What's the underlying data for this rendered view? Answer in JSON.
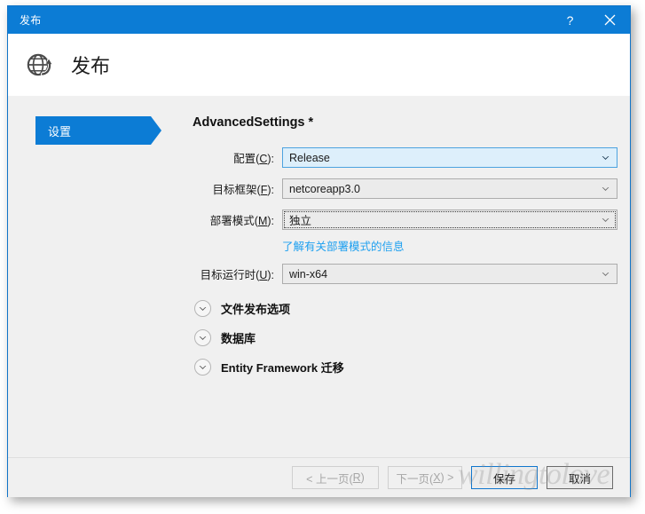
{
  "window": {
    "title": "发布",
    "help_label": "?",
    "close_label": "✕"
  },
  "header": {
    "icon": "globe-publish-icon",
    "title": "发布"
  },
  "sidebar": {
    "items": [
      {
        "label": "设置",
        "selected": true
      }
    ]
  },
  "main": {
    "section_title": "AdvancedSettings *",
    "fields": [
      {
        "label_prefix": "配置(",
        "label_key": "C",
        "label_suffix": "):",
        "value": "Release",
        "state": "focused"
      },
      {
        "label_prefix": "目标框架(",
        "label_key": "F",
        "label_suffix": "):",
        "value": "netcoreapp3.0",
        "state": "normal"
      },
      {
        "label_prefix": "部署模式(",
        "label_key": "M",
        "label_suffix": "):",
        "value": "独立",
        "state": "keyboard-focus"
      },
      {
        "label_prefix": "目标运行时(",
        "label_key": "U",
        "label_suffix": "):",
        "value": "win-x64",
        "state": "normal"
      }
    ],
    "help_link": "了解有关部署模式的信息",
    "expanders": [
      {
        "label": "文件发布选项",
        "icon": "chevron-down-icon"
      },
      {
        "label": "数据库",
        "icon": "chevron-down-icon"
      },
      {
        "label": "Entity Framework 迁移",
        "icon": "chevron-down-icon"
      }
    ]
  },
  "footer": {
    "buttons": [
      {
        "name": "previous",
        "prefix": "< 上一页(",
        "key": "R",
        "suffix": ")",
        "state": "disabled"
      },
      {
        "name": "next",
        "prefix": "下一页(",
        "key": "X",
        "suffix": ") >",
        "state": "disabled"
      },
      {
        "name": "save",
        "prefix": "保存",
        "key": "",
        "suffix": "",
        "state": "default"
      },
      {
        "name": "cancel",
        "prefix": "取消",
        "key": "",
        "suffix": "",
        "state": "strong"
      }
    ]
  },
  "watermark": {
    "text": "willingtolove"
  },
  "colors": {
    "title_bar": "#0c7cd5",
    "accent": "#0c7cd5",
    "body": "#f0f0f0",
    "link": "#1ea0f0",
    "focus_fill": "#ddeffb",
    "focus_border": "#4da3e0"
  }
}
